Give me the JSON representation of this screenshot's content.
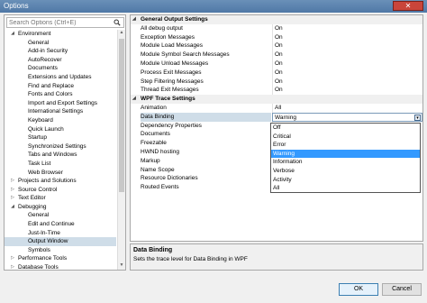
{
  "window": {
    "title": "Options",
    "close_label": "✕"
  },
  "search": {
    "placeholder": "Search Options (Ctrl+E)",
    "icon": "search-icon"
  },
  "tree": [
    {
      "label": "Environment",
      "level": 0,
      "expanded": true
    },
    {
      "label": "General",
      "level": 1
    },
    {
      "label": "Add-in Security",
      "level": 1
    },
    {
      "label": "AutoRecover",
      "level": 1
    },
    {
      "label": "Documents",
      "level": 1
    },
    {
      "label": "Extensions and Updates",
      "level": 1
    },
    {
      "label": "Find and Replace",
      "level": 1
    },
    {
      "label": "Fonts and Colors",
      "level": 1
    },
    {
      "label": "Import and Export Settings",
      "level": 1
    },
    {
      "label": "International Settings",
      "level": 1
    },
    {
      "label": "Keyboard",
      "level": 1
    },
    {
      "label": "Quick Launch",
      "level": 1
    },
    {
      "label": "Startup",
      "level": 1
    },
    {
      "label": "Synchronized Settings",
      "level": 1
    },
    {
      "label": "Tabs and Windows",
      "level": 1
    },
    {
      "label": "Task List",
      "level": 1
    },
    {
      "label": "Web Browser",
      "level": 1
    },
    {
      "label": "Projects and Solutions",
      "level": 0,
      "expanded": false
    },
    {
      "label": "Source Control",
      "level": 0,
      "expanded": false
    },
    {
      "label": "Text Editor",
      "level": 0,
      "expanded": false
    },
    {
      "label": "Debugging",
      "level": 0,
      "expanded": true
    },
    {
      "label": "General",
      "level": 1
    },
    {
      "label": "Edit and Continue",
      "level": 1
    },
    {
      "label": "Just-In-Time",
      "level": 1
    },
    {
      "label": "Output Window",
      "level": 1,
      "selected": true
    },
    {
      "label": "Symbols",
      "level": 1
    },
    {
      "label": "Performance Tools",
      "level": 0,
      "expanded": false
    },
    {
      "label": "Database Tools",
      "level": 0,
      "expanded": false
    }
  ],
  "grid": {
    "categories": [
      {
        "label": "General Output Settings",
        "rows": [
          {
            "name": "All debug output",
            "value": "On"
          },
          {
            "name": "Exception Messages",
            "value": "On"
          },
          {
            "name": "Module Load Messages",
            "value": "On"
          },
          {
            "name": "Module Symbol Search Messages",
            "value": "On"
          },
          {
            "name": "Module Unload Messages",
            "value": "On"
          },
          {
            "name": "Process Exit Messages",
            "value": "On"
          },
          {
            "name": "Step Filtering Messages",
            "value": "On"
          },
          {
            "name": "Thread Exit Messages",
            "value": "On"
          }
        ]
      },
      {
        "label": "WPF Trace Settings",
        "rows": [
          {
            "name": "Animation",
            "value": "All"
          },
          {
            "name": "Data Binding",
            "value": "Warning",
            "selected": true
          },
          {
            "name": "Dependency Properties",
            "value": ""
          },
          {
            "name": "Documents",
            "value": ""
          },
          {
            "name": "Freezable",
            "value": ""
          },
          {
            "name": "HWND hosting",
            "value": ""
          },
          {
            "name": "Markup",
            "value": ""
          },
          {
            "name": "Name Scope",
            "value": ""
          },
          {
            "name": "Resource Dictionaries",
            "value": ""
          },
          {
            "name": "Routed Events",
            "value": ""
          }
        ]
      }
    ]
  },
  "dropdown": {
    "selected": "Warning",
    "options": [
      "Off",
      "Critical",
      "Error",
      "Warning",
      "Information",
      "Verbose",
      "Activity",
      "All"
    ]
  },
  "description": {
    "title": "Data Binding",
    "text": "Sets the trace level for Data Binding in WPF"
  },
  "buttons": {
    "ok": "OK",
    "cancel": "Cancel"
  },
  "colors": {
    "selection": "#cfdde8",
    "highlight": "#3399ff",
    "titlebar": "#5a82ad"
  }
}
